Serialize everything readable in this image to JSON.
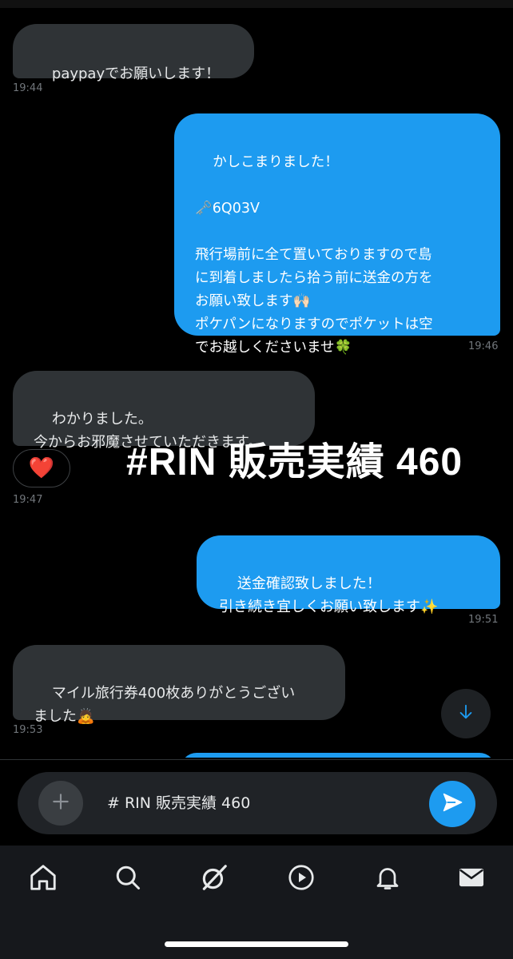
{
  "messages": [
    {
      "id": "m1",
      "dir": "in",
      "text": "paypayでお願いします！",
      "time": "19:44"
    },
    {
      "id": "m2",
      "dir": "out",
      "text": "かしこまりました！\n\n🗝️6Q03V\n\n飛行場前に全て置いておりますので島\nに到着しましたら拾う前に送金の方を\nお願い致します🙌🏻\nポケパンになりますのでポケットは空\nでお越しくださいませ🍀",
      "time": "19:46"
    },
    {
      "id": "m3",
      "dir": "in",
      "text": "わかりました。\n今からお邪魔させていただきます。",
      "time": "19:47",
      "reaction": "❤️"
    },
    {
      "id": "m4",
      "dir": "out",
      "text": "送金確認致しました！\n引き続き宜しくお願い致します✨",
      "time": "19:51"
    },
    {
      "id": "m5",
      "dir": "in",
      "text": "マイル旅行券400枚ありがとうござい\nました🙇",
      "time": "19:53"
    }
  ],
  "overlay_text": "#RIN 販売実績 460",
  "composer": {
    "text": "# RIN 販売実績 460"
  },
  "icons": {
    "add": "plus-icon",
    "send": "send-icon",
    "scroll": "arrow-down-icon",
    "nav": [
      "home-icon",
      "search-icon",
      "grok-icon",
      "play-icon",
      "bell-icon",
      "mail-icon"
    ]
  },
  "colors": {
    "accent": "#1d9bf0",
    "incoming_bubble": "#2f3336",
    "background": "#000000"
  }
}
